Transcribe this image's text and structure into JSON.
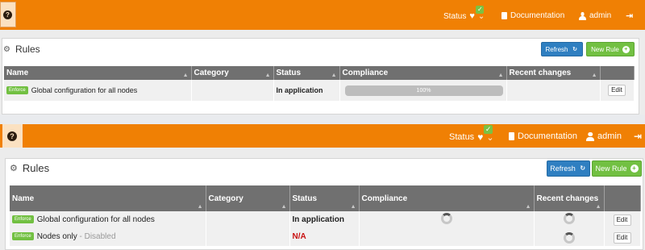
{
  "colors": {
    "topbar": "#f08004",
    "enforce_badge": "#72c042",
    "refresh_button": "#2f7fc1",
    "new_rule_button": "#72c042",
    "table_header": "#707070",
    "na_status": "#c81010"
  },
  "frame1": {
    "topbar": {
      "help": "?",
      "status": "Status",
      "documentation": "Documentation",
      "user": "admin"
    },
    "panel": {
      "title": "Rules",
      "refresh": "Refresh",
      "new_rule": "New Rule"
    },
    "columns": [
      "Name",
      "Category",
      "Status",
      "Compliance",
      "Recent changes",
      ""
    ],
    "rows": [
      {
        "mode": "Enforce",
        "name": "Global configuration for all nodes",
        "category": "",
        "status": "In application",
        "compliance": 100,
        "compliance_label": "100%",
        "edit": "Edit"
      }
    ]
  },
  "frame2": {
    "topbar": {
      "help": "?",
      "status": "Status",
      "documentation": "Documentation",
      "user": "admin"
    },
    "panel": {
      "title": "Rules",
      "refresh": "Refresh",
      "new_rule": "New Rule"
    },
    "columns": [
      "Name",
      "Category",
      "Status",
      "Compliance",
      "Recent changes",
      ""
    ],
    "rows": [
      {
        "mode": "Enforce",
        "name": "Global configuration for all nodes",
        "category": "",
        "status": "In application",
        "edit": "Edit"
      },
      {
        "mode": "Enforce",
        "name": "Nodes only",
        "disabled_note": "- Disabled",
        "category": "",
        "status": "N/A",
        "edit": "Edit"
      }
    ]
  },
  "icons": {
    "help": "question-circle-icon",
    "status": "heartbeat-icon",
    "status_ok": "check-icon",
    "caret": "chevron-down-icon",
    "documentation": "book-icon",
    "user": "user-icon",
    "logout": "logout-icon",
    "rules": "gears-icon",
    "refresh": "refresh-icon",
    "new_rule": "plus-circle-icon",
    "sort": "sort-icon",
    "loading": "spinner-icon"
  }
}
